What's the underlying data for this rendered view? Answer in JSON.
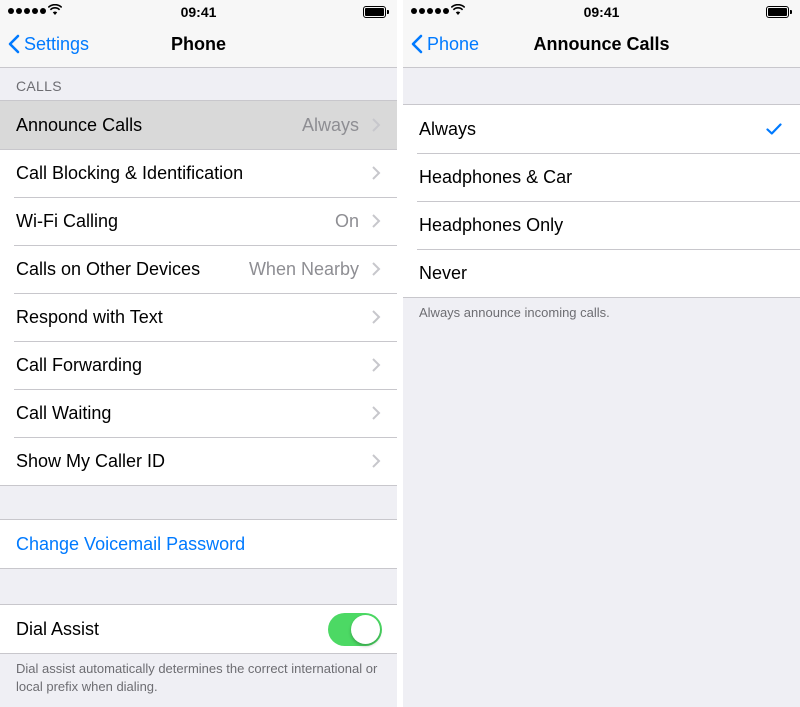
{
  "status_bar": {
    "time": "09:41"
  },
  "left": {
    "back_label": "Settings",
    "title": "Phone",
    "calls_header": "CALLS",
    "calls_rows": [
      {
        "label": "Announce Calls",
        "value": "Always"
      },
      {
        "label": "Call Blocking & Identification",
        "value": ""
      },
      {
        "label": "Wi-Fi Calling",
        "value": "On"
      },
      {
        "label": "Calls on Other Devices",
        "value": "When Nearby"
      },
      {
        "label": "Respond with Text",
        "value": ""
      },
      {
        "label": "Call Forwarding",
        "value": ""
      },
      {
        "label": "Call Waiting",
        "value": ""
      },
      {
        "label": "Show My Caller ID",
        "value": ""
      }
    ],
    "voicemail_label": "Change Voicemail Password",
    "dial_assist_label": "Dial Assist",
    "dial_assist_on": true,
    "dial_assist_footer": "Dial assist automatically determines the correct international or local prefix when dialing."
  },
  "right": {
    "back_label": "Phone",
    "title": "Announce Calls",
    "options": [
      "Always",
      "Headphones & Car",
      "Headphones Only",
      "Never"
    ],
    "selected": "Always",
    "footer": "Always announce incoming calls."
  },
  "colors": {
    "accent": "#007aff",
    "toggle_on": "#4cd964",
    "background": "#efeff4",
    "secondary_text": "#8e8e93",
    "row_highlight": "#d9d9d9"
  }
}
